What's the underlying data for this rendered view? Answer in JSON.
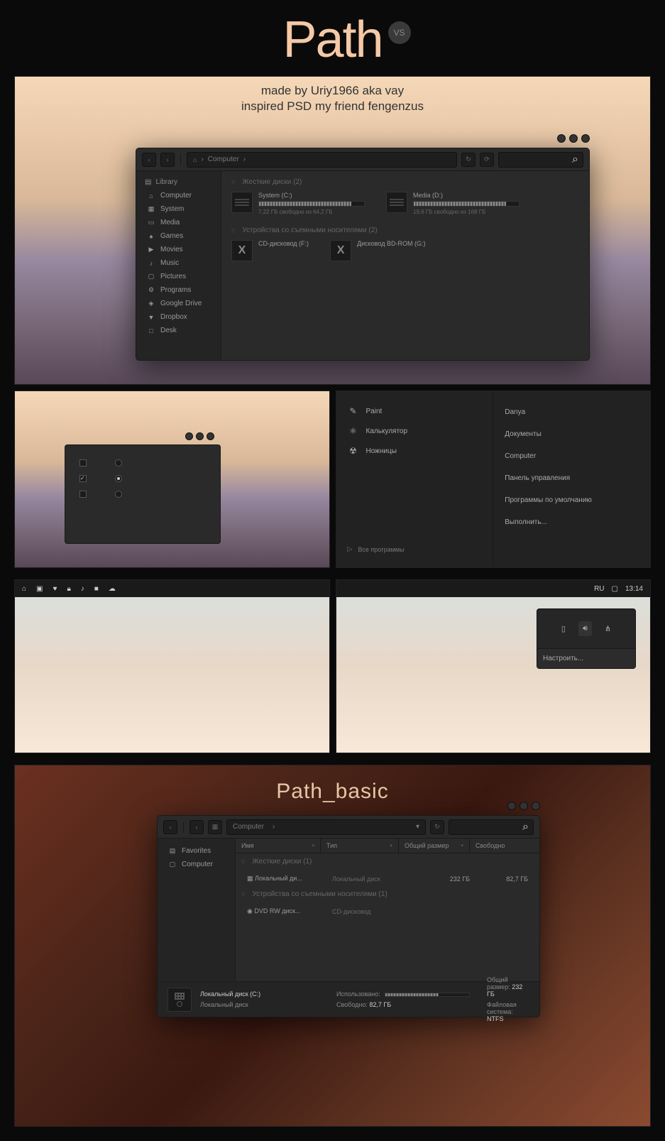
{
  "title": "Path",
  "badge": "VS",
  "credits": {
    "line1": "made by Uriy1966 aka vay",
    "line2": "inspired PSD my friend fengenzus"
  },
  "explorer1": {
    "breadcrumb": "Computer",
    "sidebar": {
      "header": "Library",
      "items": [
        {
          "icon": "⌂",
          "label": "Computer"
        },
        {
          "icon": "▦",
          "label": "System"
        },
        {
          "icon": "▭",
          "label": "Media"
        },
        {
          "icon": "♠",
          "label": "Games"
        },
        {
          "icon": "▶",
          "label": "Movies"
        },
        {
          "icon": "♪",
          "label": "Music"
        },
        {
          "icon": "▢",
          "label": "Pictures"
        },
        {
          "icon": "⚙",
          "label": "Programs"
        },
        {
          "icon": "◈",
          "label": "Google Drive"
        },
        {
          "icon": "▼",
          "label": "Dropbox"
        },
        {
          "icon": "□",
          "label": "Desk"
        }
      ]
    },
    "cat1": "Жесткие диски (2)",
    "cat2": "Устройства со съемными носителями (2)",
    "drives": [
      {
        "name": "System (C:)",
        "free": "7,22 ГБ свободно из 64,2 ГБ",
        "pct": 88
      },
      {
        "name": "Media (D:)",
        "free": "19,6 ГБ свободно из 168 ГБ",
        "pct": 88
      }
    ],
    "removable": [
      {
        "name": "CD-дисковод (F:)"
      },
      {
        "name": "Дисковод BD-ROM (G:)"
      }
    ]
  },
  "startmenu": {
    "apps": [
      {
        "icon": "✎",
        "label": "Paint"
      },
      {
        "icon": "⚛",
        "label": "Калькулятор"
      },
      {
        "icon": "☢",
        "label": "Ножницы"
      }
    ],
    "all": "Все программы",
    "links": [
      "Danya",
      "Документы",
      "Computer",
      "Панель управления",
      "Программы по умолчанию",
      "Выполнить..."
    ]
  },
  "taskbar": {
    "lang": "RU",
    "time": "13:14",
    "config": "Настроить..."
  },
  "subtitle": "Path_basic",
  "explorer2": {
    "breadcrumb": "Computer",
    "sidebar": [
      {
        "icon": "▤",
        "label": "Favorites"
      },
      {
        "icon": "▢",
        "label": "Computer"
      }
    ],
    "columns": {
      "c1": "Имя",
      "c2": "Тип",
      "c3": "Общий размер",
      "c4": "Свободно"
    },
    "cat1": "Жесткие диски (1)",
    "cat2": "Устройства со съемными носителями (1)",
    "rows": [
      {
        "icon": "▦",
        "name": "Локальный ди...",
        "type": "Локальный диск",
        "size": "232 ГБ",
        "free": "82,7 ГБ"
      },
      {
        "icon": "◉",
        "name": "DVD RW диск...",
        "type": "CD-дисковод",
        "size": "",
        "free": ""
      }
    ],
    "status": {
      "title": "Локальный диск (C:)",
      "type": "Локальный диск",
      "used_label": "Использовано:",
      "free_label": "Свободно:",
      "free_val": "82,7 ГБ",
      "total_label": "Общий размер:",
      "total_val": "232 ГБ",
      "fs_label": "Файловая система:",
      "fs_val": "NTFS",
      "used_pct": 64
    }
  }
}
